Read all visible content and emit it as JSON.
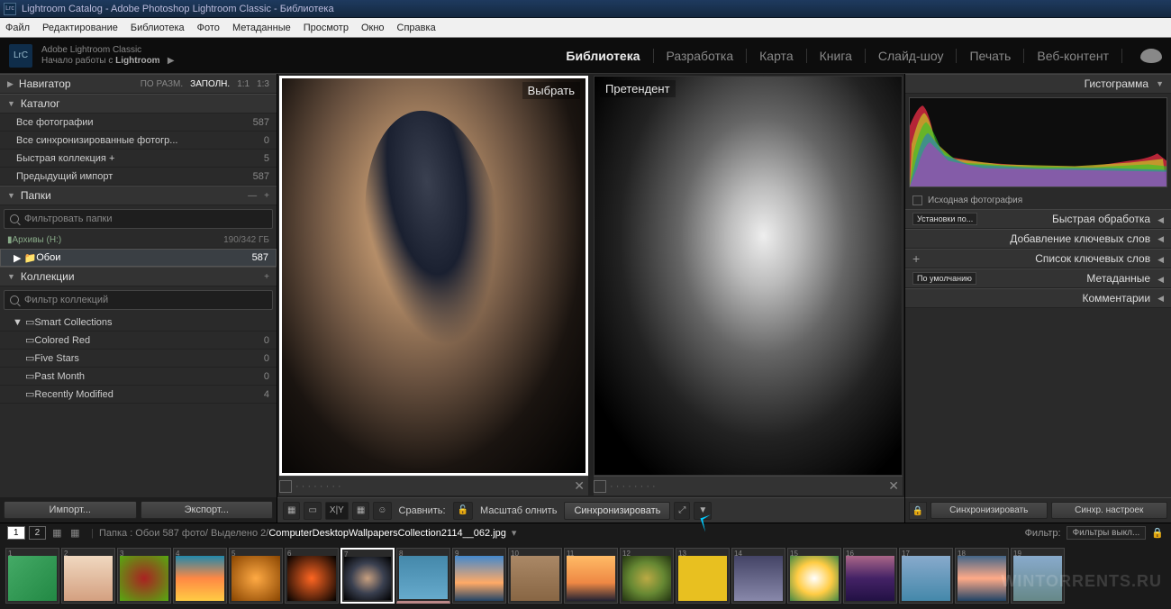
{
  "window": {
    "title": "Lightroom Catalog - Adobe Photoshop Lightroom Classic - Библиотека"
  },
  "menu": {
    "file": "Файл",
    "edit": "Редактирование",
    "library": "Библиотека",
    "photo": "Фото",
    "metadata": "Метаданные",
    "view": "Просмотр",
    "window": "Окно",
    "help": "Справка"
  },
  "top": {
    "product": "Adobe Lightroom Classic",
    "tagline": "Начало работы с ",
    "brand": "Lightroom"
  },
  "modules": {
    "library": "Библиотека",
    "develop": "Разработка",
    "map": "Карта",
    "book": "Книга",
    "slideshow": "Слайд-шоу",
    "print": "Печать",
    "web": "Веб-контент"
  },
  "left": {
    "navigator": {
      "title": "Навигатор",
      "fit": "ПО РАЗМ.",
      "fill": "ЗАПОЛН.",
      "r1": "1:1",
      "r2": "1:3"
    },
    "catalog": {
      "title": "Каталог",
      "all": "Все фотографии",
      "all_ct": "587",
      "sync": "Все синхронизированные фотогр...",
      "sync_ct": "0",
      "quick": "Быстрая коллекция  +",
      "quick_ct": "5",
      "prev": "Предыдущий импорт",
      "prev_ct": "587"
    },
    "folders": {
      "title": "Папки",
      "filter": "Фильтровать папки",
      "vol": "Архивы (H:)",
      "vol_sz": "190/342 ГБ",
      "folder": "Обои",
      "folder_ct": "587"
    },
    "collections": {
      "title": "Коллекции",
      "filter": "Фильтр коллекций",
      "smart": "Smart Collections",
      "items": [
        {
          "n": "Colored Red",
          "c": "0"
        },
        {
          "n": "Five Stars",
          "c": "0"
        },
        {
          "n": "Past Month",
          "c": "0"
        },
        {
          "n": "Recently Modified",
          "c": "4"
        }
      ]
    },
    "import": "Импорт...",
    "export": "Экспорт..."
  },
  "compare": {
    "select": "Выбрать",
    "candidate": "Претендент"
  },
  "toolbar": {
    "compare": "Сравнить:",
    "scale": "Масштаб   олнить",
    "sync": "Синхронизировать"
  },
  "right": {
    "histogram": "Гистограмма",
    "original": "Исходная фотография",
    "preset_sel": "Установки по...",
    "quick": "Быстрая обработка",
    "keywording": "Добавление ключевых слов",
    "keywordlist": "Список ключевых слов",
    "meta_sel": "По умолчанию",
    "metadata": "Метаданные",
    "comments": "Комментарии",
    "sync": "Синхронизировать",
    "syncset": "Синхр. настроек"
  },
  "infobar": {
    "p1": "1",
    "p2": "2",
    "path": "Папка :  Обои   587 фото/",
    "sel": "Выделено 2/",
    "file": "ComputerDesktopWallpapersCollection2114__062.jpg",
    "filter": "Фильтр:",
    "filter_sel": "Фильтры выкл..."
  },
  "watermark": "WINTORRENTS.RU"
}
